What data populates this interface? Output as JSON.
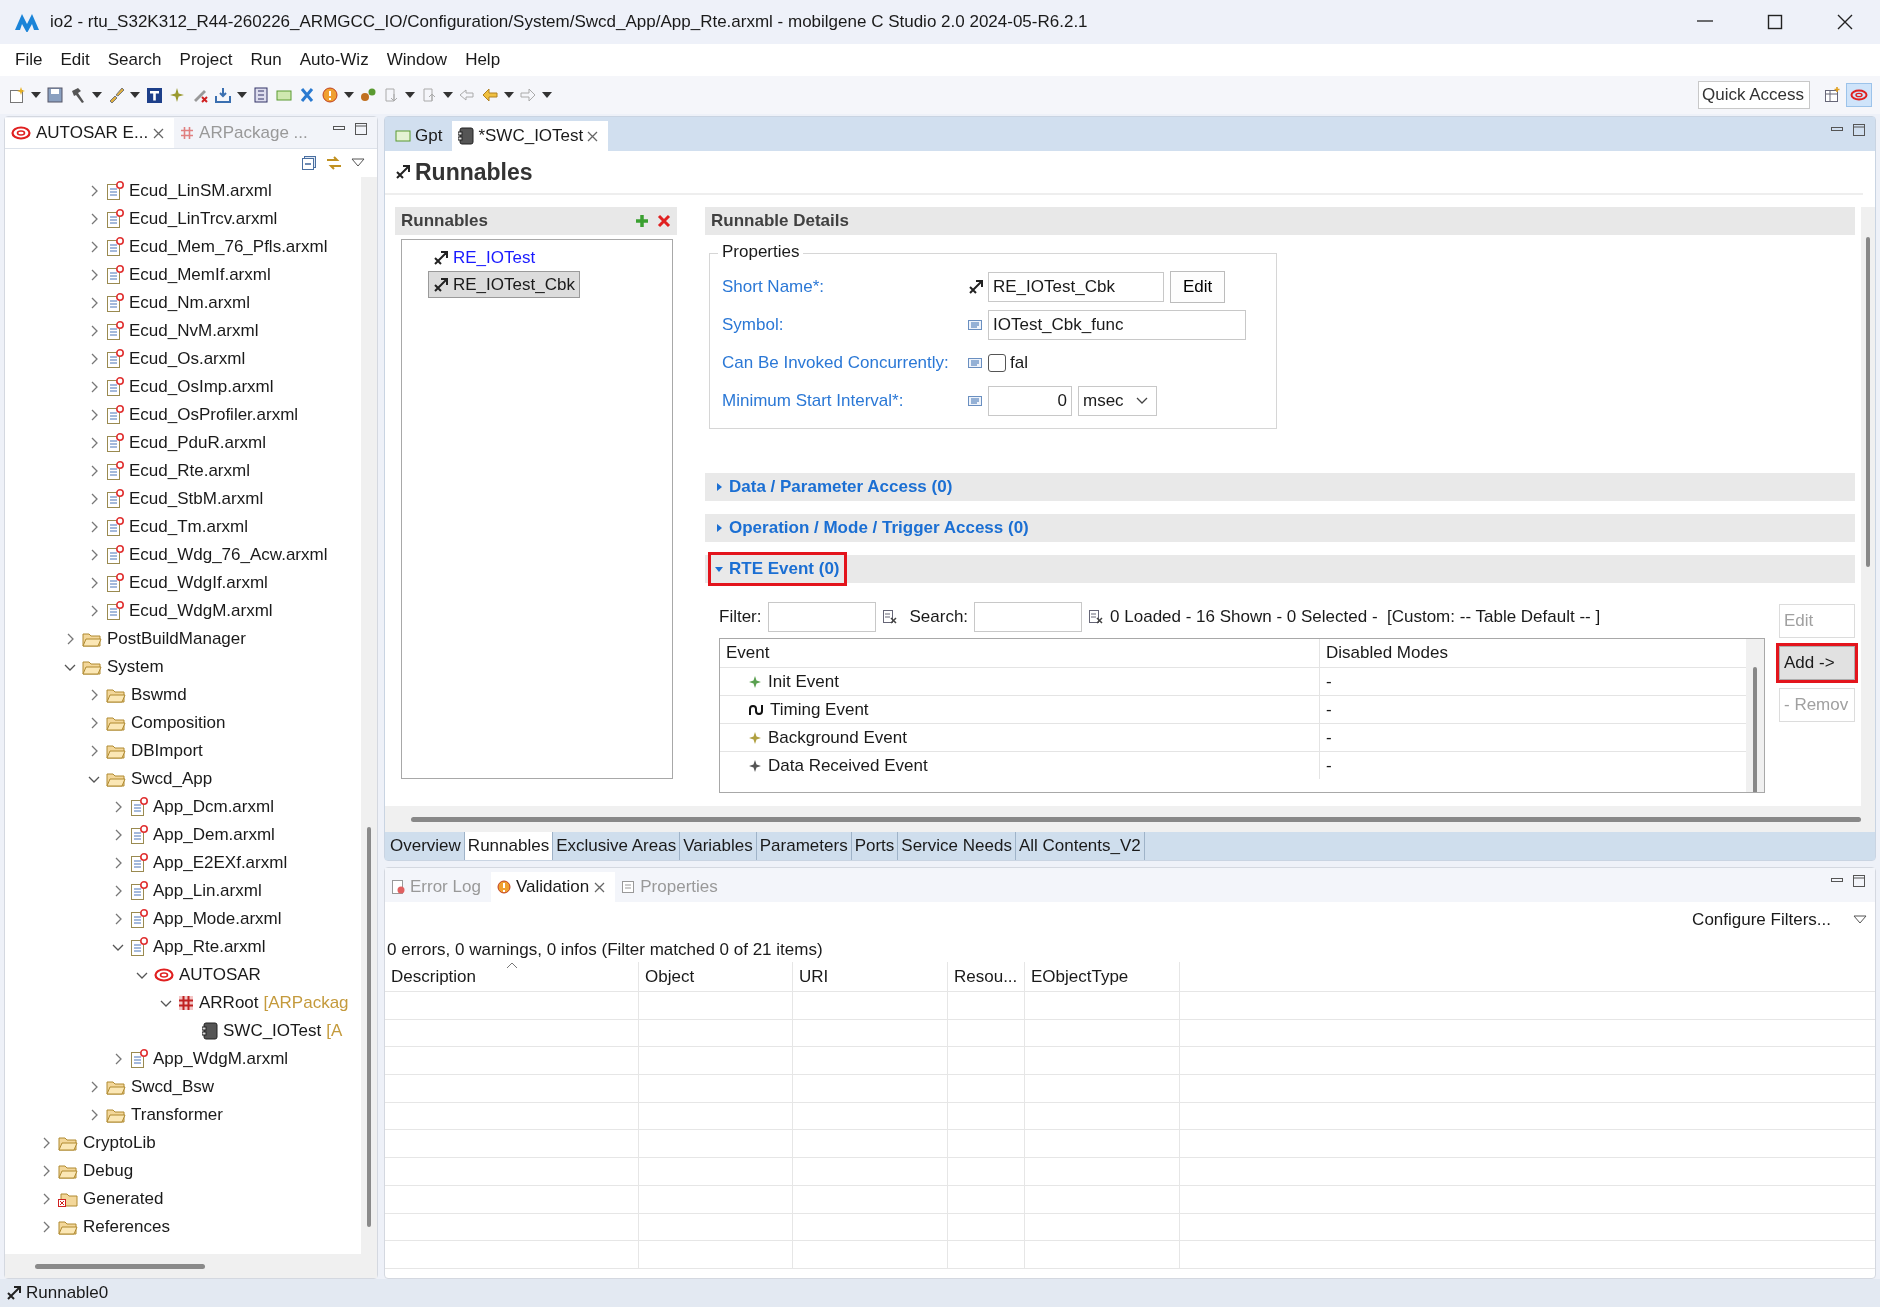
{
  "window": {
    "title": "io2 - rtu_S32K312_R44-260226_ARMGCC_IO/Configuration/System/Swcd_App/App_Rte.arxml - mobilgene C Studio 2.0 2024-05-R6.2.1"
  },
  "menu": [
    "File",
    "Edit",
    "Search",
    "Project",
    "Run",
    "Auto-Wiz",
    "Window",
    "Help"
  ],
  "quick_access": {
    "placeholder": "Quick Access"
  },
  "explorer": {
    "tabs": [
      {
        "label": "AUTOSAR E...",
        "selected": true
      },
      {
        "label": "ARPackage ...",
        "selected": false
      }
    ],
    "tree": [
      {
        "children": [
          {
            "children": [
              {
                "label": "Ecud_LinSM.arxml",
                "kind": "file",
                "expanded": false
              },
              {
                "label": "Ecud_LinTrcv.arxml",
                "kind": "file",
                "expanded": false
              },
              {
                "label": "Ecud_Mem_76_Pfls.arxml",
                "kind": "file",
                "expanded": false
              },
              {
                "label": "Ecud_MemIf.arxml",
                "kind": "file",
                "expanded": false
              },
              {
                "label": "Ecud_Nm.arxml",
                "kind": "file",
                "expanded": false
              },
              {
                "label": "Ecud_NvM.arxml",
                "kind": "file",
                "expanded": false
              },
              {
                "label": "Ecud_Os.arxml",
                "kind": "file",
                "expanded": false
              },
              {
                "label": "Ecud_OsImp.arxml",
                "kind": "file",
                "expanded": false
              },
              {
                "label": "Ecud_OsProfiler.arxml",
                "kind": "file",
                "expanded": false
              },
              {
                "label": "Ecud_PduR.arxml",
                "kind": "file",
                "expanded": false
              },
              {
                "label": "Ecud_Rte.arxml",
                "kind": "file",
                "expanded": false
              },
              {
                "label": "Ecud_StbM.arxml",
                "kind": "file",
                "expanded": false
              },
              {
                "label": "Ecud_Tm.arxml",
                "kind": "file",
                "expanded": false
              },
              {
                "label": "Ecud_Wdg_76_Acw.arxml",
                "kind": "file",
                "expanded": false
              },
              {
                "label": "Ecud_WdgIf.arxml",
                "kind": "file",
                "expanded": false
              },
              {
                "label": "Ecud_WdgM.arxml",
                "kind": "file",
                "expanded": false
              }
            ]
          },
          {
            "label": "PostBuildManager",
            "kind": "folder",
            "expanded": false
          },
          {
            "label": "System",
            "kind": "folder",
            "expanded": true,
            "children": [
              {
                "label": "Bswmd",
                "kind": "folder",
                "expanded": false
              },
              {
                "label": "Composition",
                "kind": "folder",
                "expanded": false
              },
              {
                "label": "DBImport",
                "kind": "folder",
                "expanded": false
              },
              {
                "label": "Swcd_App",
                "kind": "folder",
                "expanded": true,
                "children": [
                  {
                    "label": "App_Dcm.arxml",
                    "kind": "file",
                    "expanded": false
                  },
                  {
                    "label": "App_Dem.arxml",
                    "kind": "file",
                    "expanded": false
                  },
                  {
                    "label": "App_E2EXf.arxml",
                    "kind": "file",
                    "expanded": false
                  },
                  {
                    "label": "App_Lin.arxml",
                    "kind": "file",
                    "expanded": false
                  },
                  {
                    "label": "App_Mode.arxml",
                    "kind": "file",
                    "expanded": false
                  },
                  {
                    "label": "App_Rte.arxml",
                    "kind": "file",
                    "expanded": true,
                    "children": [
                      {
                        "label": "AUTOSAR",
                        "kind": "autosar",
                        "expanded": true,
                        "children": [
                          {
                            "label": "ARRoot",
                            "suffix": "[ARPackag",
                            "kind": "package",
                            "expanded": true,
                            "children": [
                              {
                                "label": "SWC_IOTest",
                                "suffix": "[A",
                                "kind": "component"
                              }
                            ]
                          }
                        ]
                      }
                    ]
                  },
                  {
                    "label": "App_WdgM.arxml",
                    "kind": "file",
                    "expanded": false
                  }
                ]
              },
              {
                "label": "Swcd_Bsw",
                "kind": "folder",
                "expanded": false
              },
              {
                "label": "Transformer",
                "kind": "folder",
                "expanded": false
              }
            ]
          }
        ]
      },
      {
        "label": "CryptoLib",
        "kind": "folder",
        "expanded": false
      },
      {
        "label": "Debug",
        "kind": "folder",
        "expanded": false
      },
      {
        "label": "Generated",
        "kind": "generated-folder",
        "expanded": false
      },
      {
        "label": "References",
        "kind": "folder",
        "expanded": false
      }
    ]
  },
  "editor": {
    "tabs": [
      {
        "label": "Gpt",
        "kind": "plain",
        "selected": false
      },
      {
        "label": "*SWC_IOTest",
        "kind": "component",
        "selected": true
      }
    ],
    "page_title": "Runnables",
    "runnables": {
      "title": "Runnables",
      "items": [
        {
          "label": "RE_IOTest",
          "selected": false
        },
        {
          "label": "RE_IOTest_Cbk",
          "selected": true
        }
      ]
    },
    "details": {
      "title": "Runnable Details",
      "properties": {
        "title": "Properties",
        "short_name": {
          "label": "Short Name*:",
          "value": "RE_IOTest_Cbk",
          "button": "Edit"
        },
        "symbol": {
          "label": "Symbol:",
          "value": "IOTest_Cbk_func"
        },
        "concurrent": {
          "label": "Can Be Invoked Concurrently:",
          "checked": false,
          "text": "fal"
        },
        "min_interval": {
          "label": "Minimum Start Interval*:",
          "value": "0",
          "unit": "msec"
        }
      },
      "sections": [
        {
          "title": "Data / Parameter Access (0)",
          "expanded": false,
          "highlighted": false
        },
        {
          "title": "Operation / Mode / Trigger Access (0)",
          "expanded": false,
          "highlighted": false
        },
        {
          "title": "RTE Event (0)",
          "expanded": true,
          "highlighted": true
        }
      ],
      "rte_event": {
        "filter_label": "Filter:",
        "search_label": "Search:",
        "summary": "0 Loaded - 16 Shown - 0 Selected -  [Custom: -- Table Default -- ]",
        "columns": [
          "Event",
          "Disabled Modes"
        ],
        "rows": [
          {
            "event": "Init Event",
            "kind": "init",
            "disabled_modes": "-"
          },
          {
            "event": "Timing Event",
            "kind": "timing",
            "disabled_modes": "-"
          },
          {
            "event": "Background Event",
            "kind": "background",
            "disabled_modes": "-"
          },
          {
            "event": "Data Received Event",
            "kind": "data",
            "disabled_modes": "-"
          }
        ],
        "buttons": [
          {
            "label": "Edit",
            "disabled": true,
            "highlighted": false
          },
          {
            "label": "Add ->",
            "disabled": false,
            "highlighted": true
          },
          {
            "label": "- Remov",
            "disabled": true,
            "highlighted": false
          }
        ]
      }
    },
    "page_tabs": [
      {
        "label": "Overview",
        "selected": false
      },
      {
        "label": "Runnables",
        "selected": true
      },
      {
        "label": "Exclusive Areas",
        "selected": false
      },
      {
        "label": "Variables",
        "selected": false
      },
      {
        "label": "Parameters",
        "selected": false
      },
      {
        "label": "Ports",
        "selected": false
      },
      {
        "label": "Service Needs",
        "selected": false
      },
      {
        "label": "All Contents_V2",
        "selected": false
      }
    ]
  },
  "views": {
    "tabs": [
      {
        "label": "Error Log",
        "kind": "log",
        "selected": false
      },
      {
        "label": "Validation",
        "kind": "validation",
        "selected": true
      },
      {
        "label": "Properties",
        "kind": "properties",
        "selected": false
      }
    ],
    "configure_filters": "Configure Filters...",
    "summary": "0 errors, 0 warnings, 0 infos (Filter matched 0 of 21 items)",
    "columns": [
      {
        "label": "Description",
        "sorted": true
      },
      {
        "label": "Object",
        "sorted": false
      },
      {
        "label": "URI",
        "sorted": false
      },
      {
        "label": "Resou...",
        "sorted": false
      },
      {
        "label": "EObjectType",
        "sorted": false
      }
    ]
  },
  "status_bar": {
    "text": "Runnable0"
  }
}
